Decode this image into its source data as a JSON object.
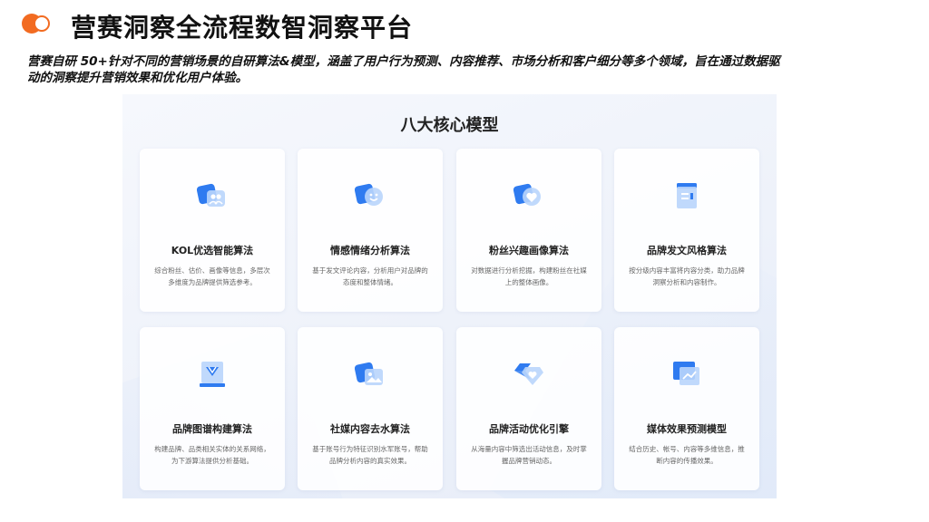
{
  "header": {
    "title": "营赛洞察全流程数智洞察平台",
    "intro": "营赛自研 50+针对不同的营销场景的自研算法&模型，涵盖了用户行为预测、内容推荐、市场分析和客户细分等多个领域，旨在通过数据驱动的洞察提升营销效果和优化用户体验。"
  },
  "panel": {
    "title": "八大核心模型",
    "cards": [
      {
        "name": "KOL优选智能算法",
        "desc": "综合粉丝、估价、画像等信息，多层次多维度为品牌提供筛选参考。",
        "icon": "users-icon"
      },
      {
        "name": "情感情绪分析算法",
        "desc": "基于发文评论内容，分析用户对品牌的态度和整体情绪。",
        "icon": "smile-icon"
      },
      {
        "name": "粉丝兴趣画像算法",
        "desc": "对数据进行分析挖掘，构建粉丝在社媒上的整体画像。",
        "icon": "heart-icon"
      },
      {
        "name": "品牌发文风格算法",
        "desc": "按分级内容丰富将内容分类，助力品牌洞察分析和内容制作。",
        "icon": "document-icon"
      },
      {
        "name": "品牌图谱构建算法",
        "desc": "构建品牌、品类相关实体的关系网络，为下游算法提供分析基础。",
        "icon": "graph-icon"
      },
      {
        "name": "社媒内容去水算法",
        "desc": "基于账号行为特征识别水军账号，帮助品牌分析内容的真实效果。",
        "icon": "image-icon"
      },
      {
        "name": "品牌活动优化引擎",
        "desc": "从海量内容中筛选出活动信息，及时掌握品牌营销动态。",
        "icon": "shield-icon"
      },
      {
        "name": "媒体效果预测模型",
        "desc": "结合历史、帐号、内容等多维信息，推断内容的传播效果。",
        "icon": "chart-icon"
      }
    ]
  },
  "colors": {
    "accent": "#f26b21",
    "icon_blue": "#2f7bf0",
    "icon_light": "#9cc3fb"
  }
}
